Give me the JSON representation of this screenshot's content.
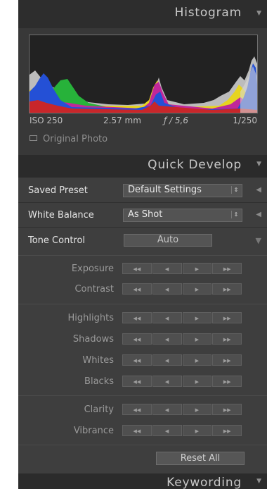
{
  "histogram": {
    "title": "Histogram",
    "iso": "ISO 250",
    "focal_length": "2.57 mm",
    "aperture": "ƒ / 5,6",
    "shutter": "1/250",
    "original_photo_label": "Original Photo"
  },
  "quick_develop": {
    "title": "Quick Develop",
    "saved_preset": {
      "label": "Saved Preset",
      "value": "Default Settings"
    },
    "white_balance": {
      "label": "White Balance",
      "value": "As Shot"
    },
    "tone_control": {
      "label": "Tone Control",
      "auto_label": "Auto"
    },
    "controls": {
      "exposure": "Exposure",
      "contrast": "Contrast",
      "highlights": "Highlights",
      "shadows": "Shadows",
      "whites": "Whites",
      "blacks": "Blacks",
      "clarity": "Clarity",
      "vibrance": "Vibrance"
    },
    "reset_all": "Reset All"
  },
  "keywording": {
    "title": "Keywording"
  },
  "icons": {
    "collapse": "triangle-down-icon",
    "expand": "triangle-left-icon",
    "stepper": [
      "double-left-icon",
      "left-icon",
      "right-icon",
      "double-right-icon"
    ]
  },
  "colors": {
    "panel": "#3e3e3e",
    "header": "#2b2b2b",
    "text": "#e4e4e4",
    "muted": "#9a9a9a"
  }
}
